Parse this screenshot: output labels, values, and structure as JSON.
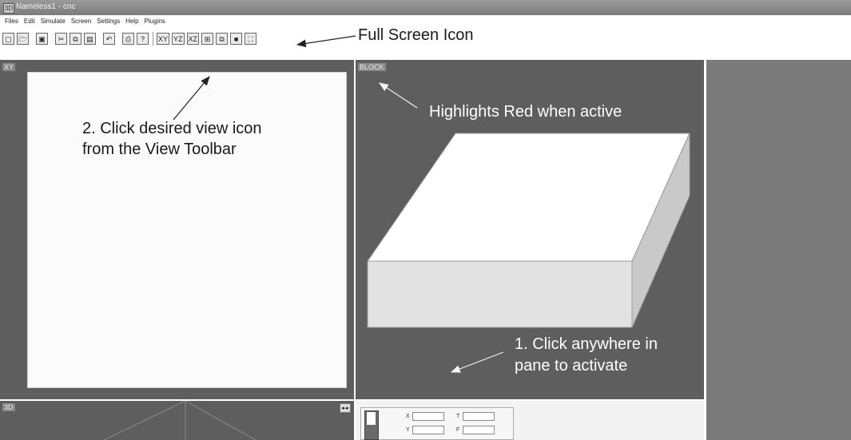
{
  "window": {
    "title": "Nameless1 - cnc",
    "app_icon_label": "3D"
  },
  "menu": [
    "Files",
    "Edit",
    "Simulate",
    "Screen",
    "Settings",
    "Help",
    "Plugins"
  ],
  "toolbar": {
    "file_icons": [
      "new-file",
      "open",
      "save",
      "cut",
      "copy",
      "paste",
      "undo",
      "print",
      "help"
    ],
    "file_glyphs": [
      "▢",
      "🗁",
      "▣",
      "✂",
      "⧉",
      "▤",
      "↶",
      "⎙",
      "?"
    ],
    "views": [
      "XY",
      "YZ",
      "XZ"
    ],
    "view_icons": [
      "iso-view",
      "wireframe-view",
      "solid-view",
      "full-screen"
    ],
    "view_glyphs": [
      "⊞",
      "⧉",
      "■",
      "⛶"
    ]
  },
  "panes": {
    "xy_label": "XY",
    "block_label": "BLOCK",
    "3d_label": "3D"
  },
  "coords": {
    "x": "X",
    "y": "Y",
    "t": "T",
    "f": "F"
  },
  "annotations": {
    "full_screen": "Full Screen Icon",
    "highlight": "Highlights Red when active",
    "click_view_1": "2. Click desired view icon",
    "click_view_2": "from the View Toolbar",
    "click_pane_1": "1. Click anywhere in",
    "click_pane_2": "pane to activate"
  },
  "colors": {
    "pane_bg": "#5e5e5e",
    "right_pane": "#7a7a7a",
    "block_top": "#ffffff",
    "block_front": "#e2e2e2",
    "block_side": "#c9c9c9"
  }
}
